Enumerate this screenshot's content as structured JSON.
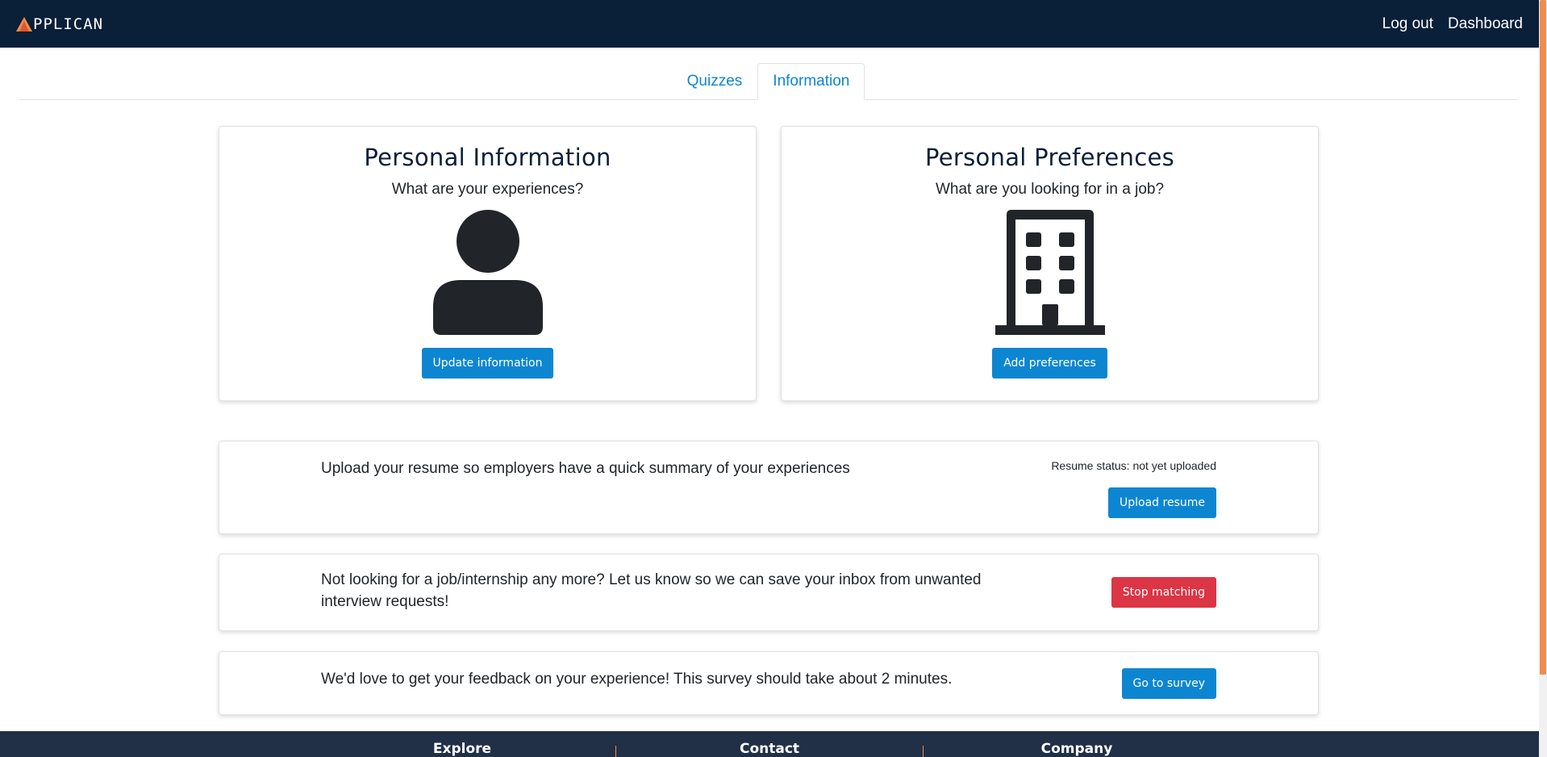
{
  "navbar": {
    "brand": "PPLICAN",
    "links": {
      "logout": "Log out",
      "dashboard": "Dashboard"
    }
  },
  "tabs": [
    {
      "label": "Quizzes",
      "active": false
    },
    {
      "label": "Information",
      "active": true
    }
  ],
  "cards": {
    "personal_info": {
      "title": "Personal Information",
      "subtitle": "What are your experiences?",
      "icon": "person-icon",
      "button": "Update information"
    },
    "preferences": {
      "title": "Personal Preferences",
      "subtitle": "What are you looking for in a job?",
      "icon": "building-icon",
      "button": "Add preferences"
    }
  },
  "resume": {
    "text": "Upload your resume so employers have a quick summary of your experiences",
    "status": "Resume status: not yet uploaded",
    "button": "Upload resume"
  },
  "stop": {
    "text": "Not looking for a job/internship any more? Let us know so we can save your inbox from unwanted interview requests!",
    "button": "Stop matching"
  },
  "survey": {
    "text": "We'd love to get your feedback on your experience! This survey should take about 2 minutes.",
    "button": "Go to survey"
  },
  "footer": {
    "columns": [
      "Explore",
      "Contact",
      "Company"
    ]
  },
  "colors": {
    "navbar": "#0a1f38",
    "primary": "#0d86d1",
    "danger": "#dc3545",
    "accent": "#f08c50",
    "footer": "#213047"
  }
}
